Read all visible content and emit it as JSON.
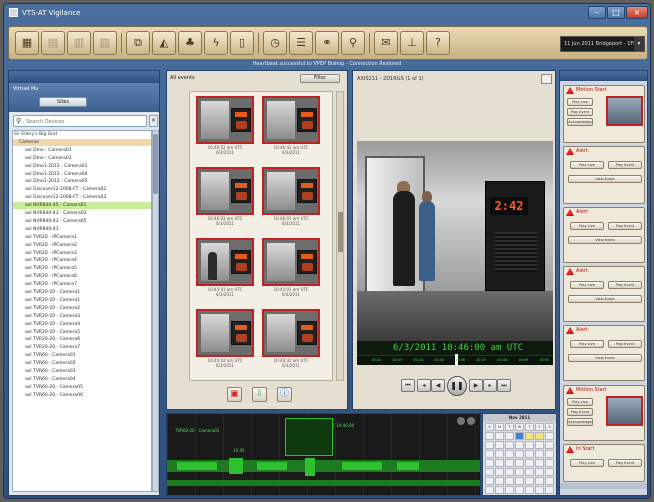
{
  "window": {
    "title": "VTS-AT Vigilance"
  },
  "toolbar": {
    "camera_selector": "11 Jun 2011 Bridgeport - 1FPC"
  },
  "status_message": "Heartbeat successful to VPEP Bishop - Connection Restored",
  "left_panel": {
    "site_label": "Virtual Mu",
    "site_button": "Sites",
    "search_placeholder": "Search Devices",
    "tree_root": "Sir Ellery's Big Grid",
    "tree_group": "Cameras",
    "items": [
      "axl Dmo - Camera01",
      "axl Dmo - Camera03",
      "axl Dmo1-2012 - Camera01",
      "axl Dmo1-2012 - Camera04",
      "axl Dmo1-2012 - Camera05",
      "axl Discover12-2008-FT - Camera02",
      "axl Discover12-2008-FT - Camera03",
      "axl NVR840-45 - Camera01",
      "axl NVR840-43 - Camera03",
      "axl NVR840-43 - Camera05",
      "axl NVR840-43 - ",
      "axl TVR20 - IPCamera1",
      "axl TVR20 - IPCamera2",
      "axl TVR20 - IPCamera3",
      "axl TVR20 - IPCamera4",
      "axl TVR20 - IPCamera5",
      "axl TVR20 - IPCamera6",
      "axl TVR20 - IPCamera7",
      "axl TVR20-20 - Camera1",
      "axl TVR20-20 - Camera1",
      "axl TVR20-20 - Camera2",
      "axl TVR20-20 - Camera3",
      "axl TVR20-20 - Camera4",
      "axl TVR20-20 - Camera5",
      "axl TVR20-20 - Camera6",
      "axl TVR20-20 - Camera7",
      "axl TVR60 - Camera01",
      "axl TVR60 - Camera02",
      "axl TVR60 - Camera03",
      "axl TVR60 - Camera04",
      "axl TVR60-20 - Camera05",
      "axl TVR60-20 - Camera06"
    ],
    "selected_index": 7
  },
  "events_panel": {
    "header": "All events",
    "filter_button": "Filter",
    "thumbnails": [
      {
        "time": "10:46:52 am UTC",
        "date": "6/3/2011"
      },
      {
        "time": "10:46:42 am UTC",
        "date": "6/3/2011"
      },
      {
        "time": "10:46:02 am UTC",
        "date": "6/3/2011"
      },
      {
        "time": "10:46:01 am UTC",
        "date": "6/3/2011"
      },
      {
        "time": "10:45:41 am UTC",
        "date": "6/3/2011"
      },
      {
        "time": "10:45:01 am UTC",
        "date": "6/3/2011"
      },
      {
        "time": "10:44:42 am UTC",
        "date": "6/3/2011"
      },
      {
        "time": "10:44:31 am UTC",
        "date": "6/3/2011"
      }
    ]
  },
  "video_panel": {
    "header": "AXIS211 - 2D1RGS (1 of 1)",
    "clock_display": "2:42",
    "timestamp": "6/3/2011   10:46:00 am UTC",
    "ticks": [
      "10:42",
      "10:43",
      "10:44",
      "10:45",
      "10:46",
      "10:47",
      "10:48",
      "10:49",
      "10:50"
    ]
  },
  "alarms": [
    {
      "title": "Motion Start",
      "btn1": "Play Live",
      "btn2": "Play Event",
      "btn3": "Acknowledge",
      "has_thumb": true
    },
    {
      "title": "Alert",
      "btn1": "Play Live",
      "btn2": "Play Event",
      "btn3": "View Event",
      "has_thumb": false
    },
    {
      "title": "Alert",
      "btn1": "Play Live",
      "btn2": "Play Event",
      "btn3": "View Event",
      "has_thumb": false
    },
    {
      "title": "Alert",
      "btn1": "Play Live",
      "btn2": "Play Event",
      "btn3": "View Event",
      "has_thumb": false
    },
    {
      "title": "Alert",
      "btn1": "Play Live",
      "btn2": "Play Event",
      "btn3": "View Event",
      "has_thumb": false
    },
    {
      "title": "Motion Start",
      "btn1": "Play Live",
      "btn2": "Play Event",
      "btn3": "Acknowledge",
      "has_thumb": true
    },
    {
      "title": "In Start",
      "btn1": "Play Live",
      "btn2": "Play Event",
      "btn3": "View Event",
      "has_thumb": false
    }
  ],
  "timeline": {
    "label_left": "TVR60-20 - Camera01",
    "label_right": "6/3/2011  10:46:00",
    "time_left": "10:45",
    "time_right": "10:46"
  },
  "calendar": {
    "month": "Nov 2011",
    "days": [
      "S",
      "M",
      "T",
      "W",
      "T",
      "F",
      "S"
    ]
  }
}
